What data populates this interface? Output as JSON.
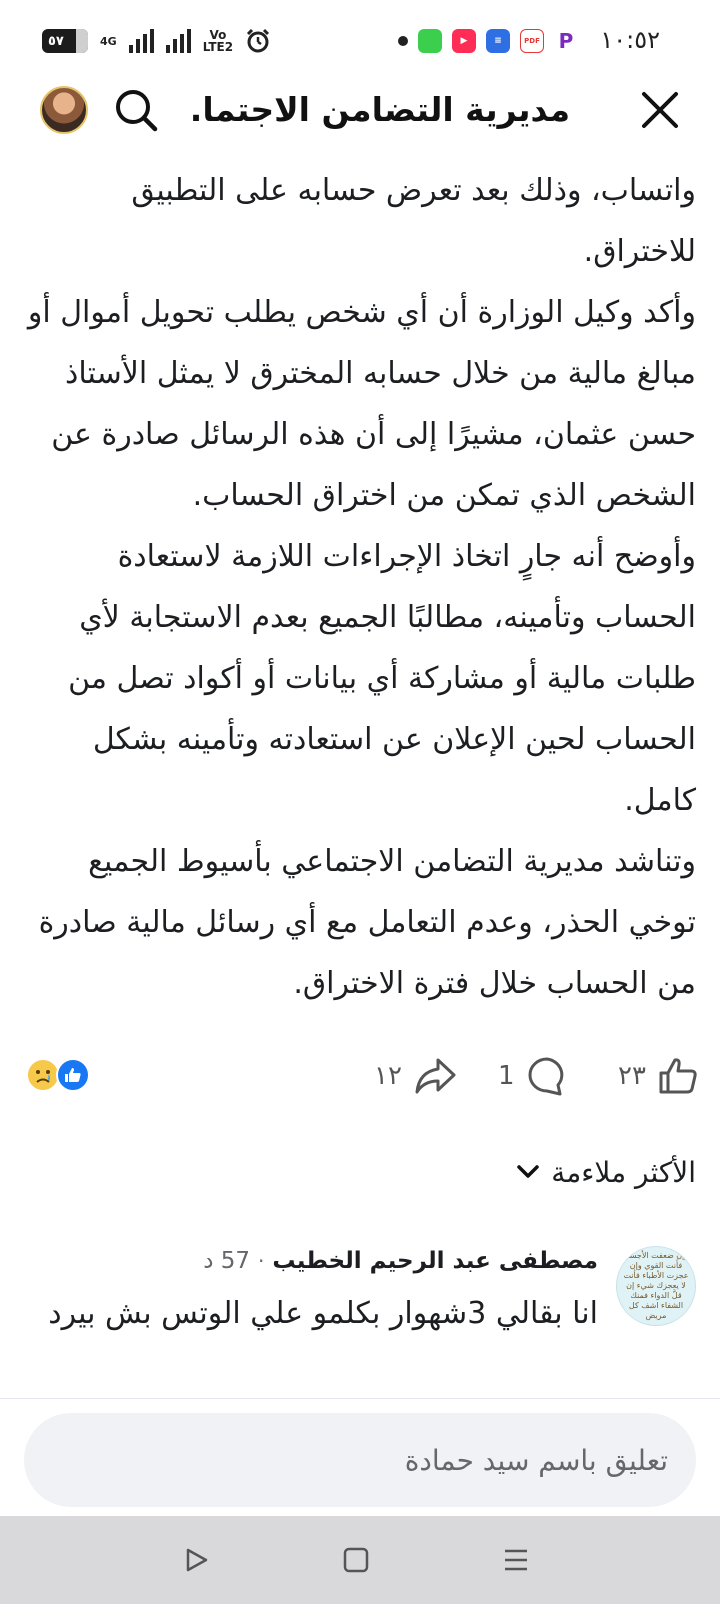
{
  "status_bar": {
    "time": "١٠:٥٢",
    "battery": "٥٧",
    "network_label": "4G",
    "volte_label_1": "Vo",
    "volte_label_2": "LTE2",
    "app_icons": [
      {
        "name": "messages",
        "color": "#3ccf4e"
      },
      {
        "name": "video-app",
        "color": "#ff2d55"
      },
      {
        "name": "docs-app",
        "color": "#2f6fe4"
      },
      {
        "name": "pdf-app",
        "color": "#e53935"
      },
      {
        "name": "p-app",
        "color": "#7b2cbf"
      }
    ]
  },
  "header": {
    "title": "مديرية التضامن الاجتما..."
  },
  "article": {
    "paragraphs": [
      "واتساب، وذلك بعد تعرض حسابه على التطبيق للاختراق.",
      "وأكد وكيل الوزارة أن أي شخص يطلب تحويل أموال أو مبالغ مالية من خلال حسابه المخترق لا يمثل الأستاذ حسن عثمان، مشيرًا إلى أن هذه الرسائل صادرة عن الشخص الذي تمكن من اختراق الحساب.",
      "وأوضح أنه جارٍ اتخاذ الإجراءات اللازمة لاستعادة الحساب وتأمينه، مطالبًا الجميع بعدم الاستجابة لأي طلبات مالية أو مشاركة أي بيانات أو أكواد تصل من الحساب لحين الإعلان عن استعادته وتأمينه بشكل كامل.",
      "وتناشد مديرية التضامن الاجتماعي بأسيوط الجميع توخي الحذر، وعدم التعامل مع أي رسائل مالية صادرة من الحساب خلال فترة الاختراق."
    ]
  },
  "reactions": {
    "like_count": "٢٣",
    "comment_count": "1",
    "share_count": "١٢"
  },
  "sort": {
    "label": "الأكثر ملاءمة"
  },
  "comment": {
    "author": "مصطفى عبد الرحيم الخطيب",
    "time": "57 د",
    "text": "انا بقالي 3شهوار بكلمو علي الوتس بش بيرد",
    "avatar_text": "وإن ضعفت الأجساد فأنت القوي وإن عجزت الأطباء فأنت لا يعجزك شيء إن قلَّ الدواء فمنك الشفاء اشف كل مريض"
  },
  "composer": {
    "placeholder": "تعليق باسم سيد حمادة"
  },
  "colors": {
    "like_blue": "#1877f2",
    "sad_yellow": "#f7c94a",
    "muted_gray": "#65676b"
  }
}
